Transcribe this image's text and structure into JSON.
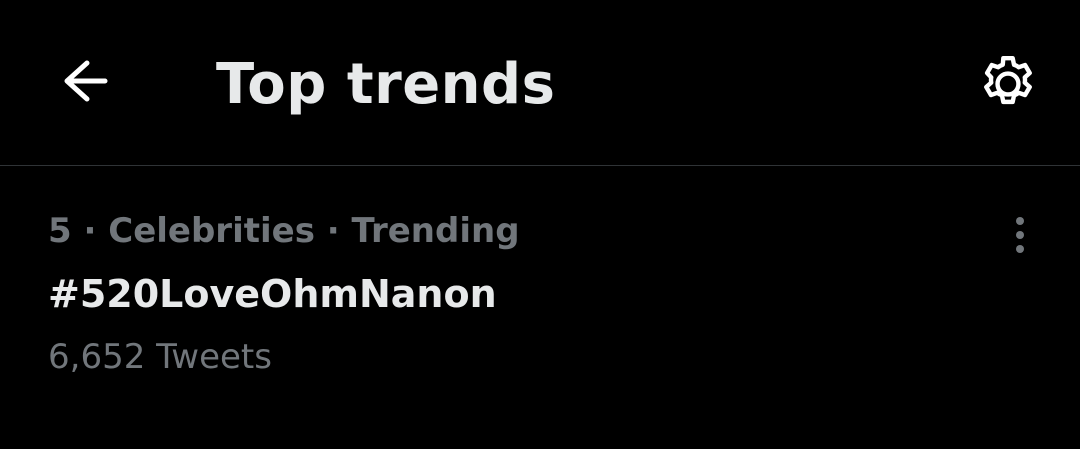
{
  "header": {
    "back_icon": "arrow-left-icon",
    "title": "Top trends",
    "settings_icon": "gear-icon"
  },
  "trends": [
    {
      "rank": "5",
      "category": "Celebrities",
      "status": "Trending",
      "meta": "5 · Celebrities · Trending",
      "name": "#520LoveOhmNanon",
      "tweet_count": "6,652 Tweets",
      "more_icon": "more-vertical-icon"
    }
  ],
  "colors": {
    "background": "#000000",
    "primary_text": "#e7e9ea",
    "secondary_text": "#71767b",
    "divider": "#2f3336"
  }
}
